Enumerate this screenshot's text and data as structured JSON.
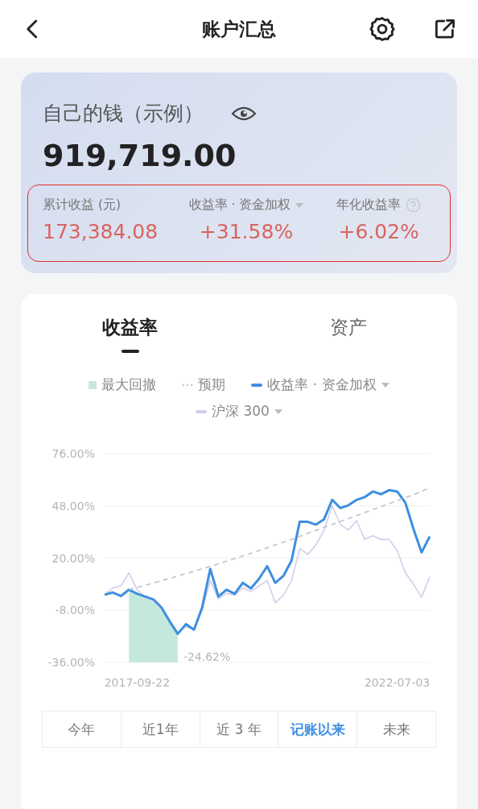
{
  "header": {
    "title": "账户汇总"
  },
  "summary": {
    "title": "自己的钱（示例）",
    "total": "919,719.00",
    "stats": [
      {
        "label": "累计收益 (元)",
        "value": "173,384.08",
        "kind": "plain"
      },
      {
        "label": "收益率 · 资金加权",
        "value": "+31.58%",
        "kind": "dropdown"
      },
      {
        "label": "年化收益率",
        "value": "+6.02%",
        "kind": "help"
      }
    ]
  },
  "tabs": [
    {
      "label": "收益率",
      "selected": true
    },
    {
      "label": "资产",
      "selected": false
    }
  ],
  "legend": [
    {
      "kind": "area",
      "label": "最大回撤",
      "color": "#c4e9dc",
      "dropdown": false
    },
    {
      "kind": "dots",
      "dropdown": false
    },
    {
      "kind": "line",
      "dropdown": true
    },
    {
      "kind": "line",
      "dropdown": true
    }
  ],
  "chart_data": {
    "type": "line",
    "grid": true,
    "categories": [
      null,
      null,
      null,
      null,
      "2017-09-22",
      null,
      null,
      null,
      null,
      null,
      null,
      null,
      null,
      null,
      null,
      null,
      null,
      null,
      null,
      null,
      null,
      null,
      null,
      null,
      null,
      null,
      null,
      null,
      null,
      null,
      null,
      null,
      null,
      null,
      null,
      null,
      "2022-07-03",
      null,
      null,
      null,
      null
    ],
    "ylim": [
      -36,
      76
    ],
    "yticks": [
      {
        "value": 76,
        "label": "76.00%"
      },
      {
        "value": 48,
        "label": "48.00%"
      },
      {
        "value": 20,
        "label": "20.00%"
      },
      {
        "value": -8,
        "label": "-8.00%"
      },
      {
        "value": -36,
        "label": "-36.00%"
      }
    ],
    "series": [
      {
        "name": "预期",
        "color": "#c4c0cc",
        "line_style": "dashed",
        "values": [
          null,
          null,
          null,
          3,
          4.2,
          5.4,
          6.6,
          7.8,
          9,
          10.3,
          11.6,
          12.9,
          14.2,
          15.5,
          16.9,
          18.3,
          19.7,
          21.1,
          22.5,
          24,
          25.5,
          27,
          28.5,
          30,
          31.6,
          33.2,
          34.8,
          36.4,
          38,
          39.6,
          41.2,
          42.8,
          44.4,
          46,
          47.6,
          49.2,
          50.8,
          52.4,
          54,
          55.8,
          57.6
        ]
      },
      {
        "name": "收益率 · 资金加权",
        "color": "#3d8fe0",
        "values": [
          0.3,
          1.5,
          -0.4,
          3,
          0.8,
          -0.7,
          -2.2,
          -6.6,
          -14,
          -20.7,
          -15.5,
          -18.5,
          -6.6,
          14.1,
          -0.7,
          3,
          0.8,
          6.7,
          3.7,
          8.9,
          15.6,
          6.7,
          10.4,
          18.6,
          39.4,
          39.4,
          37.9,
          40.8,
          51.2,
          46.8,
          48.3,
          51.2,
          52.7,
          55.7,
          54.2,
          56.4,
          55.7,
          49.7,
          35.6,
          23,
          31.6
        ]
      },
      {
        "name": "沪深 300",
        "color": "#d3cdec",
        "values": [
          0.3,
          4,
          5,
          12,
          3,
          -1,
          -3,
          -7,
          -14,
          -20,
          -17,
          -18,
          -8,
          8,
          -2,
          1,
          0,
          4,
          2,
          5,
          8,
          -4,
          0,
          8,
          25,
          22,
          27,
          35,
          48,
          38,
          35,
          40,
          30,
          32,
          30,
          30,
          24,
          12,
          6,
          -1,
          10
        ]
      }
    ],
    "annotations": [
      {
        "text": "-24.62%"
      }
    ]
  },
  "ranges": [
    {
      "label": "今年",
      "selected": false
    },
    {
      "label": "近1年",
      "selected": false
    },
    {
      "label": "近 3 年",
      "selected": false
    },
    {
      "label": "记账以来",
      "selected": true
    },
    {
      "label": "未来",
      "selected": false
    }
  ]
}
